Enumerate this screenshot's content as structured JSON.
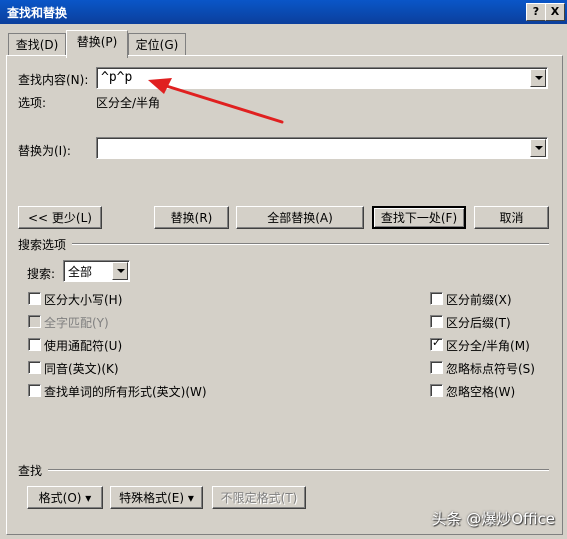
{
  "window": {
    "title": "查找和替换",
    "help_label": "?",
    "close_label": "X"
  },
  "tabs": [
    {
      "label": "查找(D)"
    },
    {
      "label": "替换(P)"
    },
    {
      "label": "定位(G)"
    }
  ],
  "find": {
    "label": "查找内容(N):",
    "value": "^p^p",
    "options_label": "选项:",
    "options_value": "区分全/半角"
  },
  "replace": {
    "label": "替换为(I):",
    "value": ""
  },
  "buttons": {
    "less": "<< 更少(L)",
    "replace": "替换(R)",
    "replace_all": "全部替换(A)",
    "find_next": "查找下一处(F)",
    "cancel": "取消"
  },
  "search_options": {
    "section_label": "搜索选项",
    "search_label": "搜索:",
    "search_value": "全部",
    "left_checks": [
      {
        "label": "区分大小写(H)",
        "checked": false,
        "disabled": false
      },
      {
        "label": "全字匹配(Y)",
        "checked": false,
        "disabled": true
      },
      {
        "label": "使用通配符(U)",
        "checked": false,
        "disabled": false
      },
      {
        "label": "同音(英文)(K)",
        "checked": false,
        "disabled": false
      },
      {
        "label": "查找单词的所有形式(英文)(W)",
        "checked": false,
        "disabled": false
      }
    ],
    "right_checks": [
      {
        "label": "区分前缀(X)",
        "checked": false
      },
      {
        "label": "区分后缀(T)",
        "checked": false
      },
      {
        "label": "区分全/半角(M)",
        "checked": true
      },
      {
        "label": "忽略标点符号(S)",
        "checked": false
      },
      {
        "label": "忽略空格(W)",
        "checked": false
      }
    ]
  },
  "footer": {
    "section_label": "查找",
    "format_label": "格式(O) ▾",
    "special_label": "特殊格式(E) ▾",
    "no_format_label": "不限定格式(T)"
  },
  "annotation": {
    "arrow_color": "#e02020"
  },
  "watermark": "头条 @爆炒Office"
}
